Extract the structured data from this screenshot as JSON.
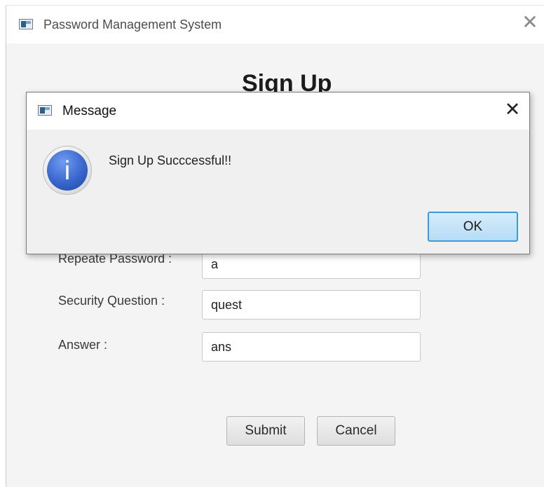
{
  "main_window": {
    "title": "Password Management System",
    "icon": "app-window-icon",
    "close_icon": "close-icon"
  },
  "form": {
    "heading": "Sign Up",
    "fields": [
      {
        "label": "Repeate Password :",
        "value": "a"
      },
      {
        "label": "Security Question :",
        "value": "quest"
      },
      {
        "label": "Answer :",
        "value": "ans"
      }
    ],
    "submit_label": "Submit",
    "cancel_label": "Cancel"
  },
  "dialog": {
    "title": "Message",
    "icon": "info-icon",
    "info_glyph": "i",
    "message": "Sign Up Succcessful!!",
    "ok_label": "OK",
    "close_icon": "close-icon"
  },
  "colors": {
    "info_blue": "#3866cc",
    "ok_border": "#3d9ad8",
    "ok_fill": "#c4e3f8"
  }
}
